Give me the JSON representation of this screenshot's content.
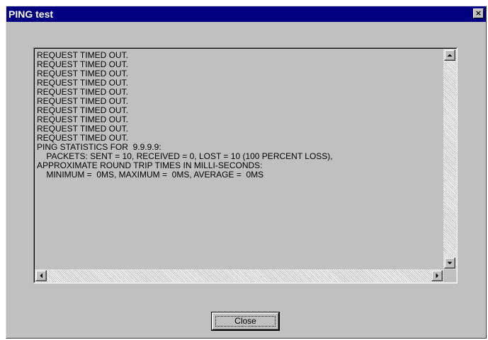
{
  "window": {
    "title": "PING test",
    "close_glyph": "×"
  },
  "output": {
    "lines": [
      "REQUEST TIMED OUT.",
      "REQUEST TIMED OUT.",
      "REQUEST TIMED OUT.",
      "REQUEST TIMED OUT.",
      "REQUEST TIMED OUT.",
      "REQUEST TIMED OUT.",
      "REQUEST TIMED OUT.",
      "REQUEST TIMED OUT.",
      "REQUEST TIMED OUT.",
      "REQUEST TIMED OUT.",
      "PING STATISTICS FOR  9.9.9.9:",
      "    PACKETS: SENT = 10, RECEIVED = 0, LOST = 10 (100 PERCENT LOSS),",
      "APPROXIMATE ROUND TRIP TIMES IN MILLI-SECONDS:",
      "    MINIMUM =  0MS, MAXIMUM =  0MS, AVERAGE =  0MS"
    ]
  },
  "footer": {
    "close_label": "Close"
  },
  "colors": {
    "titlebar": "#000080",
    "face": "#c0c0c0"
  },
  "icons": {
    "window_close": "close-icon",
    "scroll_up": "arrow-up-icon",
    "scroll_down": "arrow-down-icon",
    "scroll_left": "arrow-left-icon",
    "scroll_right": "arrow-right-icon"
  }
}
